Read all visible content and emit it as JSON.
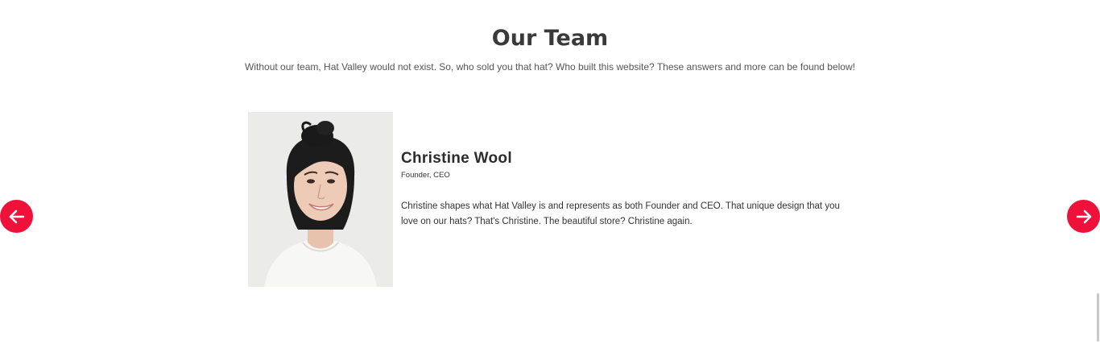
{
  "team_section": {
    "title": "Our Team",
    "intro": "Without our team, Hat Valley would not exist. So, who sold you that hat? Who built this website? These answers and more can be found below!"
  },
  "carousel": {
    "prev_icon": "arrow-left-icon",
    "next_icon": "arrow-right-icon",
    "accent_color": "#f0113a"
  },
  "member": {
    "name": "Christine Wool",
    "role": "Founder, CEO",
    "bio": "Christine shapes what Hat Valley is and represents as both Founder and CEO. That unique design that you love on our hats? That's Christine. The beautiful store? Christine again."
  }
}
